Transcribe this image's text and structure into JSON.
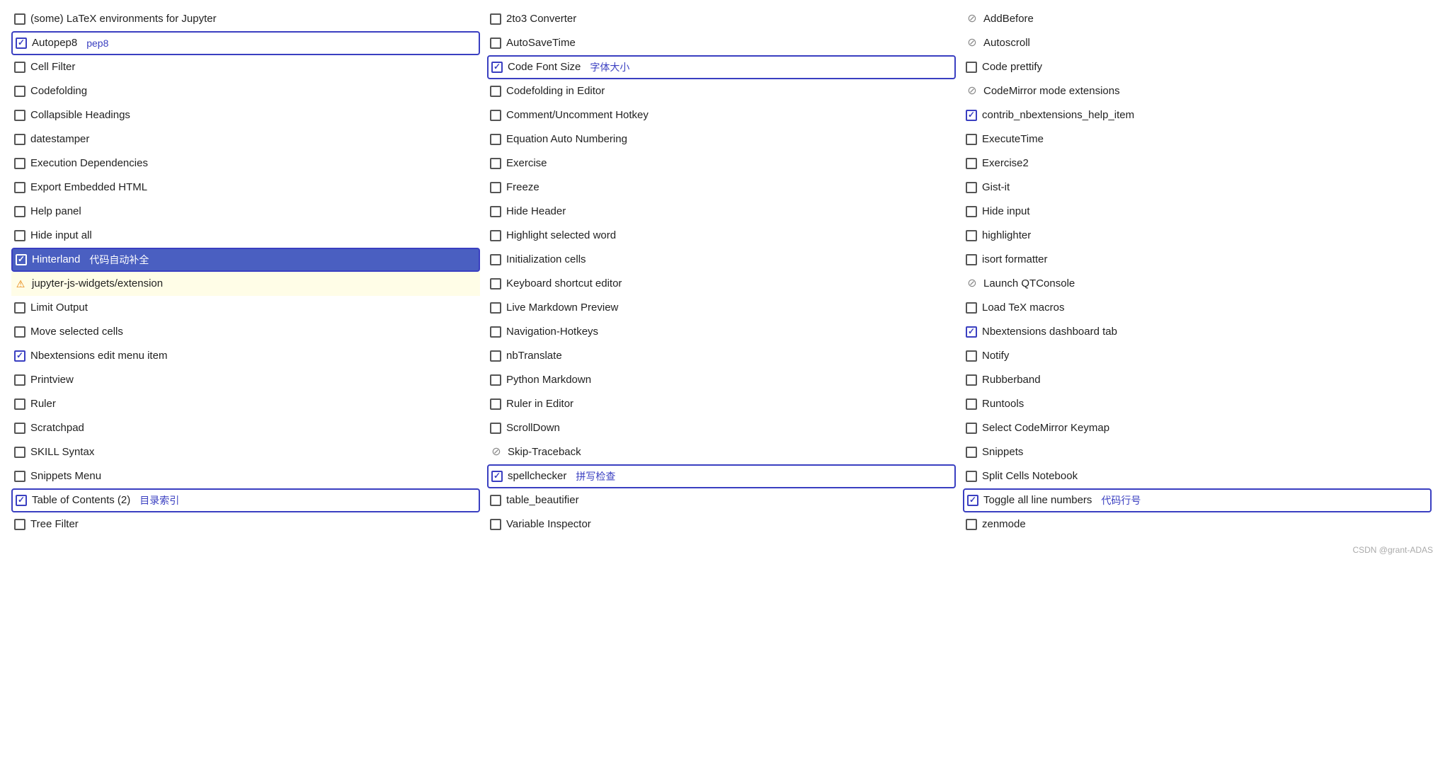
{
  "col1": {
    "items": [
      {
        "id": "latex-jupyter",
        "type": "unchecked",
        "label": "(some) LaTeX environments for Jupyter",
        "tag": "",
        "boxed": false,
        "highlighted": false,
        "warning": false,
        "disabled": false
      },
      {
        "id": "autopep8",
        "type": "checked",
        "label": "Autopep8",
        "tag": "pep8",
        "boxed": true,
        "highlighted": false,
        "warning": false,
        "disabled": false
      },
      {
        "id": "cell-filter",
        "type": "unchecked",
        "label": "Cell Filter",
        "tag": "",
        "boxed": false,
        "highlighted": false,
        "warning": false,
        "disabled": false
      },
      {
        "id": "codefolding",
        "type": "unchecked",
        "label": "Codefolding",
        "tag": "",
        "boxed": false,
        "highlighted": false,
        "warning": false,
        "disabled": false
      },
      {
        "id": "collapsible-headings",
        "type": "unchecked",
        "label": "Collapsible Headings",
        "tag": "",
        "boxed": false,
        "highlighted": false,
        "warning": false,
        "disabled": false
      },
      {
        "id": "datestamper",
        "type": "unchecked",
        "label": "datestamper",
        "tag": "",
        "boxed": false,
        "highlighted": false,
        "warning": false,
        "disabled": false
      },
      {
        "id": "execution-dependencies",
        "type": "unchecked",
        "label": "Execution Dependencies",
        "tag": "",
        "boxed": false,
        "highlighted": false,
        "warning": false,
        "disabled": false
      },
      {
        "id": "export-embedded-html",
        "type": "unchecked",
        "label": "Export Embedded HTML",
        "tag": "",
        "boxed": false,
        "highlighted": false,
        "warning": false,
        "disabled": false
      },
      {
        "id": "help-panel",
        "type": "unchecked",
        "label": "Help panel",
        "tag": "",
        "boxed": false,
        "highlighted": false,
        "warning": false,
        "disabled": false
      },
      {
        "id": "hide-input-all",
        "type": "unchecked",
        "label": "Hide input all",
        "tag": "",
        "boxed": false,
        "highlighted": false,
        "warning": false,
        "disabled": false
      },
      {
        "id": "hinterland",
        "type": "checked",
        "label": "Hinterland",
        "tag": "代码自动补全",
        "boxed": true,
        "highlighted": true,
        "warning": false,
        "disabled": false
      },
      {
        "id": "jupyter-js-widgets",
        "type": "warning",
        "label": "jupyter-js-widgets/extension",
        "tag": "",
        "boxed": false,
        "highlighted": false,
        "warning": true,
        "disabled": false,
        "warnbg": true
      },
      {
        "id": "limit-output",
        "type": "unchecked",
        "label": "Limit Output",
        "tag": "",
        "boxed": false,
        "highlighted": false,
        "warning": false,
        "disabled": false
      },
      {
        "id": "move-selected-cells",
        "type": "unchecked",
        "label": "Move selected cells",
        "tag": "",
        "boxed": false,
        "highlighted": false,
        "warning": false,
        "disabled": false
      },
      {
        "id": "nbextensions-edit-menu",
        "type": "checked",
        "label": "Nbextensions edit menu item",
        "tag": "",
        "boxed": false,
        "highlighted": false,
        "warning": false,
        "disabled": false
      },
      {
        "id": "printview",
        "type": "unchecked",
        "label": "Printview",
        "tag": "",
        "boxed": false,
        "highlighted": false,
        "warning": false,
        "disabled": false
      },
      {
        "id": "ruler",
        "type": "unchecked",
        "label": "Ruler",
        "tag": "",
        "boxed": false,
        "highlighted": false,
        "warning": false,
        "disabled": false
      },
      {
        "id": "scratchpad",
        "type": "unchecked",
        "label": "Scratchpad",
        "tag": "",
        "boxed": false,
        "highlighted": false,
        "warning": false,
        "disabled": false
      },
      {
        "id": "skill-syntax",
        "type": "unchecked",
        "label": "SKILL Syntax",
        "tag": "",
        "boxed": false,
        "highlighted": false,
        "warning": false,
        "disabled": false
      },
      {
        "id": "snippets-menu",
        "type": "unchecked",
        "label": "Snippets Menu",
        "tag": "",
        "boxed": false,
        "highlighted": false,
        "warning": false,
        "disabled": false
      },
      {
        "id": "toc2",
        "type": "checked",
        "label": "Table of Contents (2)",
        "tag": "目录索引",
        "boxed": true,
        "highlighted": false,
        "warning": false,
        "disabled": false
      },
      {
        "id": "tree-filter",
        "type": "unchecked",
        "label": "Tree Filter",
        "tag": "",
        "boxed": false,
        "highlighted": false,
        "warning": false,
        "disabled": false
      }
    ]
  },
  "col2": {
    "items": [
      {
        "id": "2to3-converter",
        "type": "unchecked",
        "label": "2to3 Converter",
        "tag": "",
        "boxed": false,
        "highlighted": false,
        "warning": false,
        "disabled": false
      },
      {
        "id": "autosavetime",
        "type": "unchecked",
        "label": "AutoSaveTime",
        "tag": "",
        "boxed": false,
        "highlighted": false,
        "warning": false,
        "disabled": false
      },
      {
        "id": "code-font-size",
        "type": "checked",
        "label": "Code Font Size",
        "tag": "字体大小",
        "boxed": true,
        "highlighted": false,
        "warning": false,
        "disabled": false
      },
      {
        "id": "codefolding-editor",
        "type": "unchecked",
        "label": "Codefolding in Editor",
        "tag": "",
        "boxed": false,
        "highlighted": false,
        "warning": false,
        "disabled": false
      },
      {
        "id": "comment-uncomment",
        "type": "unchecked",
        "label": "Comment/Uncomment Hotkey",
        "tag": "",
        "boxed": false,
        "highlighted": false,
        "warning": false,
        "disabled": false
      },
      {
        "id": "equation-auto-numbering",
        "type": "unchecked",
        "label": "Equation Auto Numbering",
        "tag": "",
        "boxed": false,
        "highlighted": false,
        "warning": false,
        "disabled": false
      },
      {
        "id": "exercise",
        "type": "unchecked",
        "label": "Exercise",
        "tag": "",
        "boxed": false,
        "highlighted": false,
        "warning": false,
        "disabled": false
      },
      {
        "id": "freeze",
        "type": "unchecked",
        "label": "Freeze",
        "tag": "",
        "boxed": false,
        "highlighted": false,
        "warning": false,
        "disabled": false
      },
      {
        "id": "hide-header",
        "type": "unchecked",
        "label": "Hide Header",
        "tag": "",
        "boxed": false,
        "highlighted": false,
        "warning": false,
        "disabled": false
      },
      {
        "id": "highlight-selected-word",
        "type": "unchecked",
        "label": "Highlight selected word",
        "tag": "",
        "boxed": false,
        "highlighted": false,
        "warning": false,
        "disabled": false
      },
      {
        "id": "initialization-cells",
        "type": "unchecked",
        "label": "Initialization cells",
        "tag": "",
        "boxed": false,
        "highlighted": false,
        "warning": false,
        "disabled": false
      },
      {
        "id": "keyboard-shortcut-editor",
        "type": "unchecked",
        "label": "Keyboard shortcut editor",
        "tag": "",
        "boxed": false,
        "highlighted": false,
        "warning": false,
        "disabled": false
      },
      {
        "id": "live-markdown-preview",
        "type": "unchecked",
        "label": "Live Markdown Preview",
        "tag": "",
        "boxed": false,
        "highlighted": false,
        "warning": false,
        "disabled": false
      },
      {
        "id": "navigation-hotkeys",
        "type": "unchecked",
        "label": "Navigation-Hotkeys",
        "tag": "",
        "boxed": false,
        "highlighted": false,
        "warning": false,
        "disabled": false
      },
      {
        "id": "nbtranslate",
        "type": "unchecked",
        "label": "nbTranslate",
        "tag": "",
        "boxed": false,
        "highlighted": false,
        "warning": false,
        "disabled": false
      },
      {
        "id": "python-markdown",
        "type": "unchecked",
        "label": "Python Markdown",
        "tag": "",
        "boxed": false,
        "highlighted": false,
        "warning": false,
        "disabled": false
      },
      {
        "id": "ruler-in-editor",
        "type": "unchecked",
        "label": "Ruler in Editor",
        "tag": "",
        "boxed": false,
        "highlighted": false,
        "warning": false,
        "disabled": false
      },
      {
        "id": "scrolldown",
        "type": "unchecked",
        "label": "ScrollDown",
        "tag": "",
        "boxed": false,
        "highlighted": false,
        "warning": false,
        "disabled": false
      },
      {
        "id": "skip-traceback",
        "type": "disabled",
        "label": "Skip-Traceback",
        "tag": "",
        "boxed": false,
        "highlighted": false,
        "warning": false,
        "disabled": true
      },
      {
        "id": "spellchecker",
        "type": "checked",
        "label": "spellchecker",
        "tag": "拼写检查",
        "boxed": true,
        "highlighted": false,
        "warning": false,
        "disabled": false
      },
      {
        "id": "table-beautifier",
        "type": "unchecked",
        "label": "table_beautifier",
        "tag": "",
        "boxed": false,
        "highlighted": false,
        "warning": false,
        "disabled": false
      },
      {
        "id": "variable-inspector",
        "type": "unchecked",
        "label": "Variable Inspector",
        "tag": "",
        "boxed": false,
        "highlighted": false,
        "warning": false,
        "disabled": false
      }
    ]
  },
  "col3": {
    "items": [
      {
        "id": "addbefore",
        "type": "disabled",
        "label": "AddBefore",
        "tag": "",
        "boxed": false,
        "highlighted": false,
        "warning": false,
        "disabled": true
      },
      {
        "id": "autoscroll",
        "type": "disabled",
        "label": "Autoscroll",
        "tag": "",
        "boxed": false,
        "highlighted": false,
        "warning": false,
        "disabled": true
      },
      {
        "id": "code-prettify",
        "type": "unchecked",
        "label": "Code prettify",
        "tag": "",
        "boxed": false,
        "highlighted": false,
        "warning": false,
        "disabled": false
      },
      {
        "id": "codemirror-mode-ext",
        "type": "disabled",
        "label": "CodeMirror mode extensions",
        "tag": "",
        "boxed": false,
        "highlighted": false,
        "warning": false,
        "disabled": true
      },
      {
        "id": "contrib-nbextensions-help",
        "type": "checked",
        "label": "contrib_nbextensions_help_item",
        "tag": "",
        "boxed": false,
        "highlighted": false,
        "warning": false,
        "disabled": false
      },
      {
        "id": "execute-time",
        "type": "unchecked",
        "label": "ExecuteTime",
        "tag": "",
        "boxed": false,
        "highlighted": false,
        "warning": false,
        "disabled": false
      },
      {
        "id": "exercise2",
        "type": "unchecked",
        "label": "Exercise2",
        "tag": "",
        "boxed": false,
        "highlighted": false,
        "warning": false,
        "disabled": false
      },
      {
        "id": "gist-it",
        "type": "unchecked",
        "label": "Gist-it",
        "tag": "",
        "boxed": false,
        "highlighted": false,
        "warning": false,
        "disabled": false
      },
      {
        "id": "hide-input",
        "type": "unchecked",
        "label": "Hide input",
        "tag": "",
        "boxed": false,
        "highlighted": false,
        "warning": false,
        "disabled": false
      },
      {
        "id": "highlighter",
        "type": "unchecked",
        "label": "highlighter",
        "tag": "",
        "boxed": false,
        "highlighted": false,
        "warning": false,
        "disabled": false
      },
      {
        "id": "isort-formatter",
        "type": "unchecked",
        "label": "isort formatter",
        "tag": "",
        "boxed": false,
        "highlighted": false,
        "warning": false,
        "disabled": false
      },
      {
        "id": "launch-qtconsole",
        "type": "disabled",
        "label": "Launch QTConsole",
        "tag": "",
        "boxed": false,
        "highlighted": false,
        "warning": false,
        "disabled": true
      },
      {
        "id": "load-tex-macros",
        "type": "unchecked",
        "label": "Load TeX macros",
        "tag": "",
        "boxed": false,
        "highlighted": false,
        "warning": false,
        "disabled": false
      },
      {
        "id": "nbextensions-dashboard-tab",
        "type": "checked",
        "label": "Nbextensions dashboard tab",
        "tag": "",
        "boxed": false,
        "highlighted": false,
        "warning": false,
        "disabled": false
      },
      {
        "id": "notify",
        "type": "unchecked",
        "label": "Notify",
        "tag": "",
        "boxed": false,
        "highlighted": false,
        "warning": false,
        "disabled": false
      },
      {
        "id": "rubberband",
        "type": "unchecked",
        "label": "Rubberband",
        "tag": "",
        "boxed": false,
        "highlighted": false,
        "warning": false,
        "disabled": false
      },
      {
        "id": "runtools",
        "type": "unchecked",
        "label": "Runtools",
        "tag": "",
        "boxed": false,
        "highlighted": false,
        "warning": false,
        "disabled": false
      },
      {
        "id": "select-codemirror-keymap",
        "type": "unchecked",
        "label": "Select CodeMirror Keymap",
        "tag": "",
        "boxed": false,
        "highlighted": false,
        "warning": false,
        "disabled": false
      },
      {
        "id": "snippets",
        "type": "unchecked",
        "label": "Snippets",
        "tag": "",
        "boxed": false,
        "highlighted": false,
        "warning": false,
        "disabled": false
      },
      {
        "id": "split-cells-notebook",
        "type": "unchecked",
        "label": "Split Cells Notebook",
        "tag": "",
        "boxed": false,
        "highlighted": false,
        "warning": false,
        "disabled": false
      },
      {
        "id": "toggle-all-line-numbers",
        "type": "checked",
        "label": "Toggle all line numbers",
        "tag": "代码行号",
        "boxed": true,
        "highlighted": false,
        "warning": false,
        "disabled": false
      },
      {
        "id": "zenmode",
        "type": "unchecked",
        "label": "zenmode",
        "tag": "",
        "boxed": false,
        "highlighted": false,
        "warning": false,
        "disabled": false
      }
    ]
  },
  "footer": "CSDN @grant-ADAS"
}
